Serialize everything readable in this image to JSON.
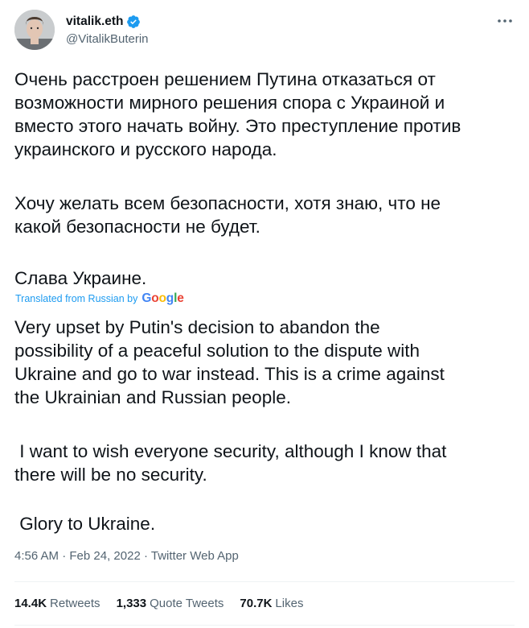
{
  "author": {
    "display_name": "vitalik.eth",
    "handle": "@VitalikButerin",
    "avatar_icon": "avatar-photo",
    "verified_icon": "verified-badge-icon",
    "verified_color": "#1d9bf0"
  },
  "menu": {
    "more_icon": "more-dots-icon"
  },
  "tweet": {
    "original": {
      "paragraph1": "Очень расстроен решением Путина отказаться от\nвозможности мирного решения спора с Украиной и\nвместо этого начать войну. Это преступление против\nукраинского и русского народа.",
      "paragraph2": "Хочу желать всем безопасности, хотя знаю, что не\nкакой безопасности не будет.",
      "paragraph3": "Слава Украине."
    },
    "translation_note": "Translated from Russian by",
    "translation_provider": "Google",
    "translated": {
      "paragraph1": "Very upset by Putin's decision to abandon the\npossibility of a peaceful solution to the dispute with\nUkraine and go to war instead. This is a crime against\nthe Ukrainian and Russian people.",
      "paragraph2": " I want to wish everyone security, although I know that\nthere will be no security.",
      "paragraph3": " Glory to Ukraine."
    }
  },
  "meta": {
    "time": "4:56 AM",
    "date": "Feb 24, 2022",
    "source": "Twitter Web App",
    "separator": "·"
  },
  "stats": {
    "retweets_count": "14.4K",
    "retweets_label": "Retweets",
    "quote_tweets_count": "1,333",
    "quote_tweets_label": "Quote Tweets",
    "likes_count": "70.7K",
    "likes_label": "Likes"
  },
  "colors": {
    "text": "#0f1419",
    "secondary": "#536471",
    "link": "#1d9bf0",
    "divider": "#eff3f4",
    "google_blue": "#4285f4",
    "google_red": "#ea4335",
    "google_yellow": "#fbbc05",
    "google_green": "#34a853"
  }
}
